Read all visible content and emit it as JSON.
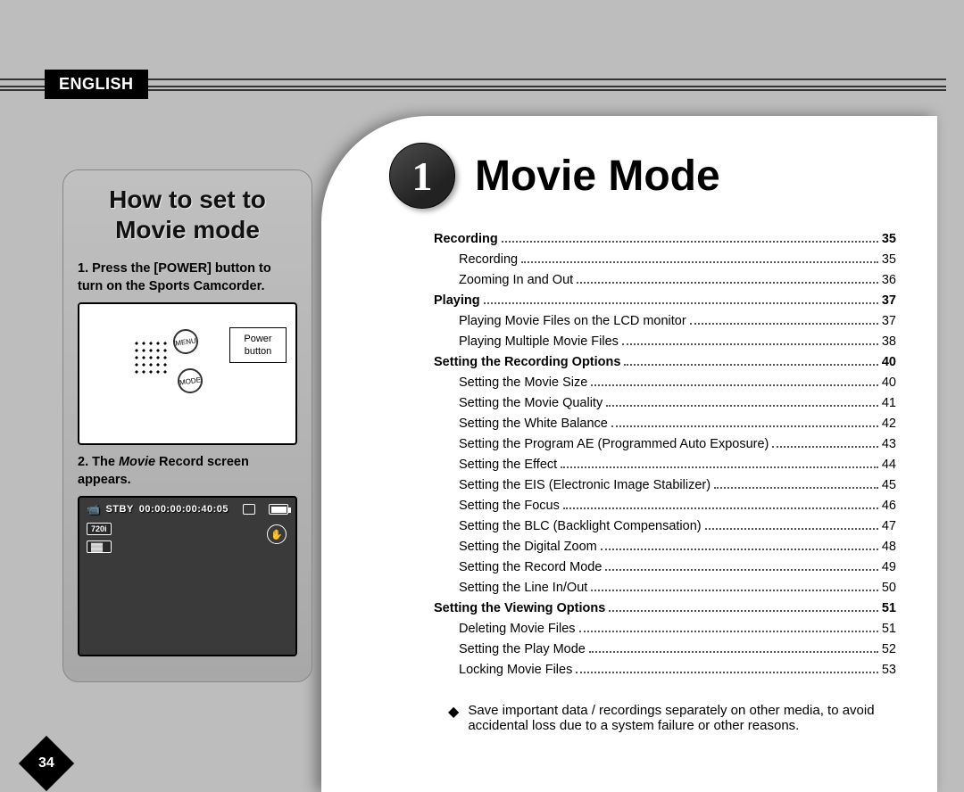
{
  "language_badge": "ENGLISH",
  "page_number": "34",
  "chapter_number": "1",
  "page_title": "Movie Mode",
  "sidebar": {
    "title_line1": "How to set to",
    "title_line2": "Movie mode",
    "step1": "1. Press the [POWER] button to turn on the Sports Camcorder.",
    "illus": {
      "power_label1": "Power",
      "power_label2": "button",
      "menu_label": "MENU",
      "mode_label": "MODE"
    },
    "step2_prefix": "2. The ",
    "step2_italic": "Movie",
    "step2_suffix": " Record screen appears.",
    "record_screen": {
      "status": "STBY",
      "time": "00:00:00:00:40:05",
      "size_badge": "720i"
    }
  },
  "toc": [
    {
      "label": "Recording",
      "page": "35",
      "level": 1
    },
    {
      "label": "Recording",
      "page": "35",
      "level": 2
    },
    {
      "label": "Zooming In and Out",
      "page": "36",
      "level": 2
    },
    {
      "label": "Playing",
      "page": "37",
      "level": 1
    },
    {
      "label": "Playing Movie Files on the LCD monitor",
      "page": "37",
      "level": 2
    },
    {
      "label": "Playing Multiple Movie Files",
      "page": "38",
      "level": 2
    },
    {
      "label": "Setting the Recording Options",
      "page": "40",
      "level": 1
    },
    {
      "label": "Setting the Movie Size",
      "page": "40",
      "level": 2
    },
    {
      "label": "Setting the Movie Quality",
      "page": "41",
      "level": 2
    },
    {
      "label": "Setting the White Balance",
      "page": "42",
      "level": 2
    },
    {
      "label": "Setting the Program AE (Programmed Auto Exposure)",
      "page": "43",
      "level": 2
    },
    {
      "label": "Setting the Effect",
      "page": "44",
      "level": 2
    },
    {
      "label": "Setting the EIS (Electronic Image Stabilizer)",
      "page": "45",
      "level": 2
    },
    {
      "label": "Setting the Focus",
      "page": "46",
      "level": 2
    },
    {
      "label": "Setting the BLC (Backlight Compensation)",
      "page": "47",
      "level": 2
    },
    {
      "label": "Setting the Digital Zoom",
      "page": "48",
      "level": 2
    },
    {
      "label": "Setting the Record Mode",
      "page": "49",
      "level": 2
    },
    {
      "label": "Setting the Line In/Out",
      "page": "50",
      "level": 2
    },
    {
      "label": "Setting the Viewing Options",
      "page": "51",
      "level": 1
    },
    {
      "label": "Deleting Movie Files",
      "page": "51",
      "level": 2
    },
    {
      "label": "Setting the Play Mode",
      "page": "52",
      "level": 2
    },
    {
      "label": "Locking Movie Files",
      "page": "53",
      "level": 2
    }
  ],
  "note_bullet": "◆",
  "note_text": "Save important data / recordings separately on other media, to avoid accidental loss due to a system failure or other reasons."
}
